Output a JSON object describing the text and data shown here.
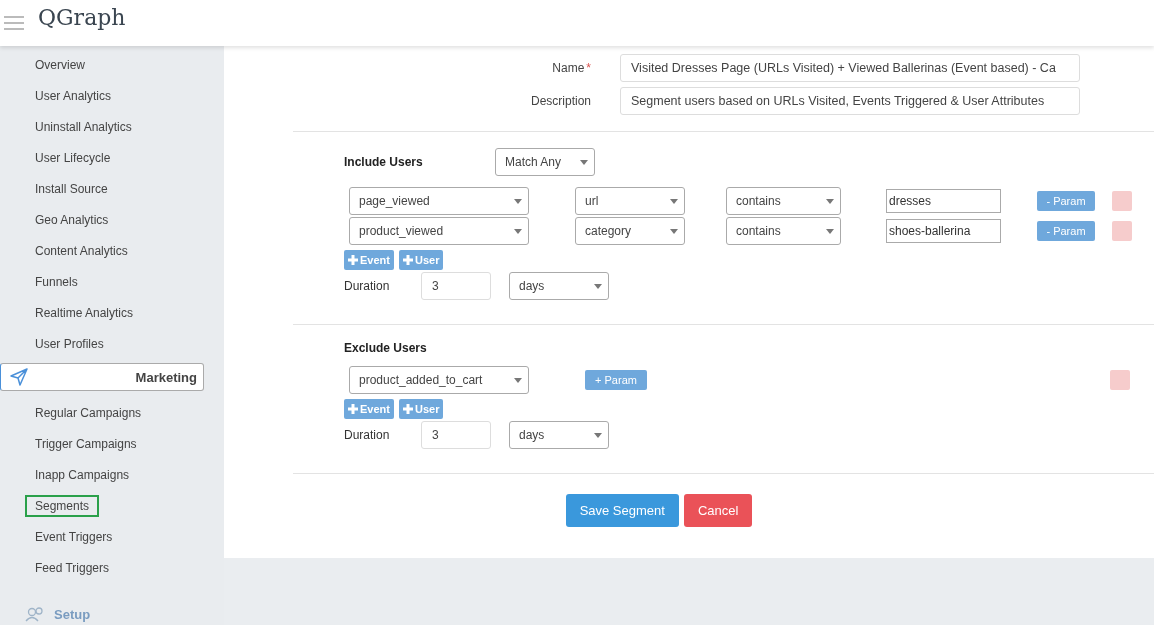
{
  "header": {
    "logo": "QGraph"
  },
  "sidebar": {
    "items": [
      {
        "kind": "link",
        "label": "Overview",
        "outlined": false
      },
      {
        "kind": "link",
        "label": "User Analytics",
        "outlined": false
      },
      {
        "kind": "link",
        "label": "Uninstall Analytics",
        "outlined": false
      },
      {
        "kind": "link",
        "label": "User Lifecycle",
        "outlined": false
      },
      {
        "kind": "link",
        "label": "Install Source",
        "outlined": false
      },
      {
        "kind": "link",
        "label": "Geo Analytics",
        "outlined": false
      },
      {
        "kind": "link",
        "label": "Content Analytics",
        "outlined": false
      },
      {
        "kind": "link",
        "label": "Funnels",
        "outlined": false
      },
      {
        "kind": "link",
        "label": "Realtime Analytics",
        "outlined": false
      },
      {
        "kind": "link",
        "label": "User Profiles",
        "outlined": false
      },
      {
        "kind": "section",
        "label": "Marketing",
        "selected": true
      },
      {
        "kind": "link",
        "label": "Regular Campaigns",
        "outlined": false
      },
      {
        "kind": "link",
        "label": "Trigger Campaigns",
        "outlined": false
      },
      {
        "kind": "link",
        "label": "Inapp Campaigns",
        "outlined": false
      },
      {
        "kind": "link",
        "label": "Segments",
        "outlined": true
      },
      {
        "kind": "link",
        "label": "Event Triggers",
        "outlined": false
      },
      {
        "kind": "link",
        "label": "Feed Triggers",
        "outlined": false
      },
      {
        "kind": "section",
        "label": "Setup",
        "selected": false
      }
    ]
  },
  "form": {
    "name_label": "Name",
    "required_mark": "*",
    "name_value": "Visited Dresses Page (URLs Visited) + Viewed Ballerinas (Event based) - Ca",
    "description_label": "Description",
    "description_value": "Segment users based on URLs Visited, Events Triggered & User Attributes"
  },
  "include": {
    "title": "Include Users",
    "match": "Match Any",
    "conditions": [
      {
        "event": "page_viewed",
        "property": "url",
        "operator": "contains",
        "value": "dresses",
        "param_button": "- Param",
        "disabled": true
      },
      {
        "event": "product_viewed",
        "property": "category",
        "operator": "contains",
        "value": "shoes-ballerina",
        "param_button": "- Param",
        "disabled": true
      }
    ],
    "add_buttons": [
      "Event",
      "User"
    ],
    "duration_label": "Duration",
    "duration_value": "3",
    "duration_unit": "days"
  },
  "exclude": {
    "title": "Exclude Users",
    "conditions": [
      {
        "event": "product_added_to_cart",
        "param_button": "+ Param",
        "disabled": true
      }
    ],
    "add_buttons": [
      "Event",
      "User"
    ],
    "duration_label": "Duration",
    "duration_value": "3",
    "duration_unit": "days"
  },
  "buttons": [
    {
      "kind": "primary",
      "label": "Save Segment"
    },
    {
      "kind": "danger",
      "label": "Cancel"
    }
  ]
}
